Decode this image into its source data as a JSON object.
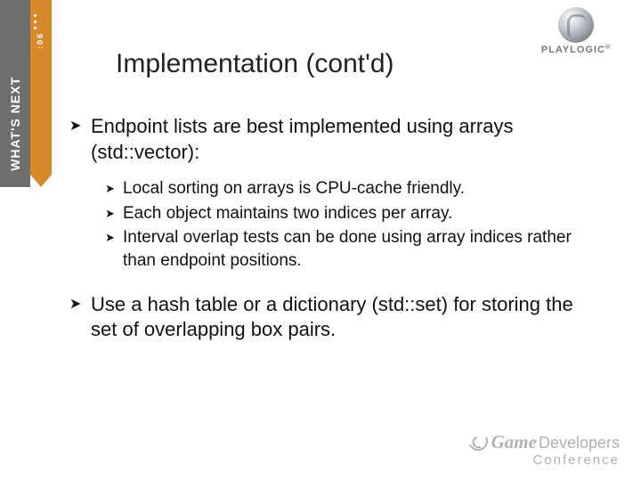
{
  "sidebar": {
    "vertical_label": "WHAT'S NEXT",
    "badge": ":06"
  },
  "logos": {
    "playlogic": "PLAYLOGIC",
    "gdc_game": "Game",
    "gdc_dev": "Developers",
    "gdc_conf": "Conference"
  },
  "title": "Implementation (cont'd)",
  "bullets": [
    {
      "text": "Endpoint lists are best implemented using arrays (std::vector):",
      "sub": [
        "Local sorting on arrays is CPU-cache friendly.",
        "Each object maintains two indices per array.",
        "Interval overlap tests can be done using array indices rather than endpoint positions."
      ]
    },
    {
      "text": "Use a hash table or a dictionary (std::set) for storing the set of overlapping box pairs.",
      "sub": []
    }
  ]
}
